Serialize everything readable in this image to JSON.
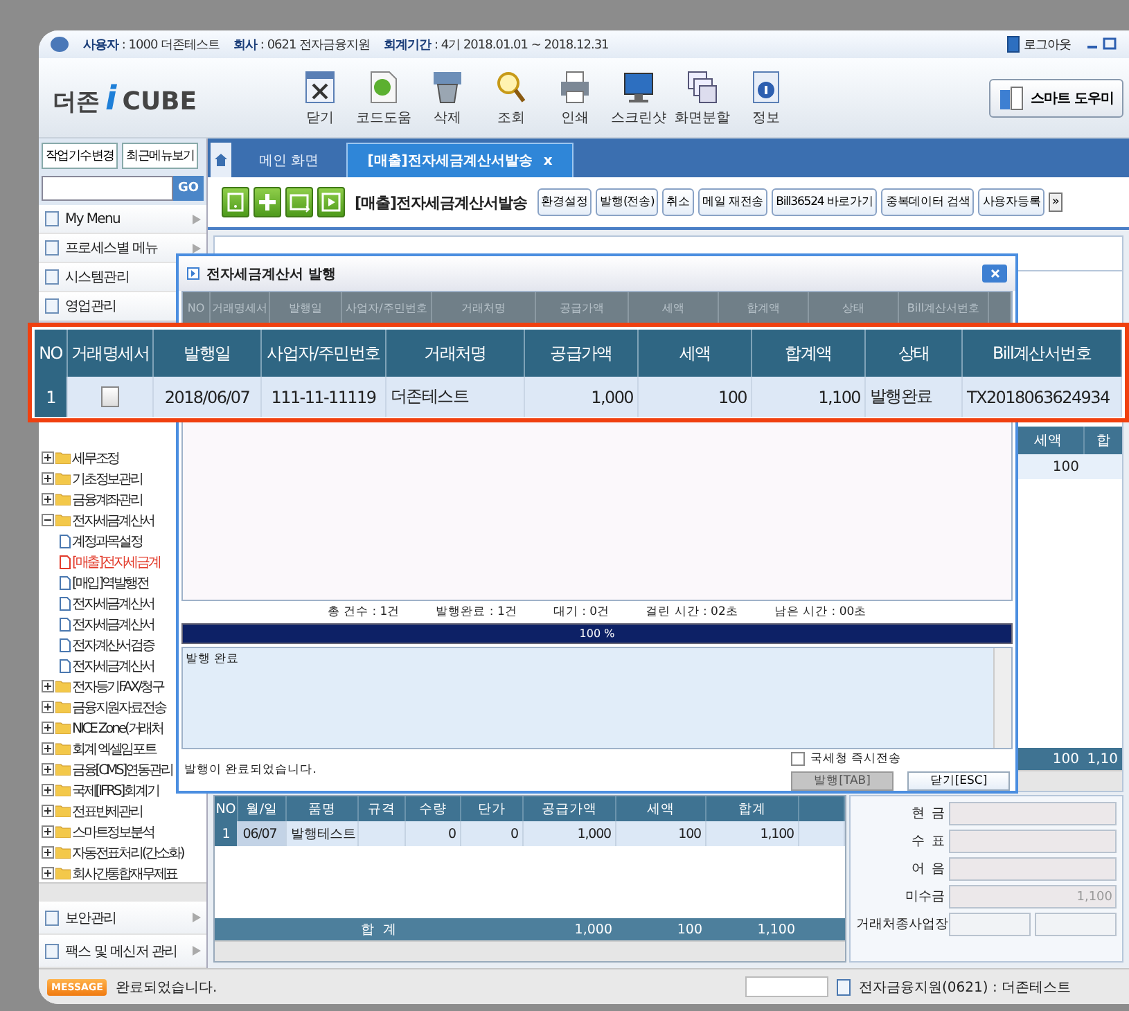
{
  "header": {
    "fields": [
      {
        "label": "사용자",
        "value": ": 1000 더존테스트"
      },
      {
        "label": "회사",
        "value": ": 0621 전자금융지원"
      },
      {
        "label": "회계기간",
        "value": ": 4기  2018.01.01 ~ 2018.12.31"
      }
    ],
    "logout": "로그아웃"
  },
  "logo": {
    "name": "더존",
    "accent": "i",
    "product": "CUBE"
  },
  "toolbar": [
    {
      "label": "닫기"
    },
    {
      "label": "코드도움"
    },
    {
      "label": "삭제"
    },
    {
      "label": "조회"
    },
    {
      "label": "인쇄"
    },
    {
      "label": "스크린샷"
    },
    {
      "label": "화면분할"
    },
    {
      "label": "정보"
    }
  ],
  "smart_helper": "스마트 도우미",
  "sidebar": {
    "buttons": [
      "작업기수변경",
      "최근메뉴보기"
    ],
    "search": {
      "button": "GO"
    },
    "menus": [
      "My Menu",
      "프로세스별 메뉴",
      "시스템관리",
      "영업관리"
    ],
    "tree": [
      {
        "label": "세무조정",
        "expanded": false
      },
      {
        "label": "기초정보관리",
        "expanded": false
      },
      {
        "label": "금융계좌관리",
        "expanded": false
      },
      {
        "label": "전자세금계산서",
        "expanded": true,
        "children": [
          {
            "label": "계정과목설정",
            "selected": false
          },
          {
            "label": "[매출]전자세금계",
            "selected": true
          },
          {
            "label": "[매입]역발행전",
            "selected": false
          },
          {
            "label": "전자세금계산서",
            "selected": false
          },
          {
            "label": "전자세금계산서",
            "selected": false
          },
          {
            "label": "전자계산서검증",
            "selected": false
          },
          {
            "label": "전자세금계산서",
            "selected": false
          }
        ]
      },
      {
        "label": "전자등기FAX/청구",
        "expanded": false
      },
      {
        "label": "금융지원자료전송",
        "expanded": false
      },
      {
        "label": "NICE Zone(거래처",
        "expanded": false
      },
      {
        "label": "회계 엑셀임포트",
        "expanded": false
      },
      {
        "label": "금융[CMS]연동관리",
        "expanded": false
      },
      {
        "label": "국제[IFRS]회계기",
        "expanded": false
      },
      {
        "label": "전표반제관리",
        "expanded": false
      },
      {
        "label": "스마트정보분석",
        "expanded": false
      },
      {
        "label": "자동전표처리(간소화)",
        "expanded": false
      },
      {
        "label": "회사간통합재무제표",
        "expanded": false
      }
    ],
    "bottom_menus": [
      "보안관리",
      "팩스 및 메신저 관리"
    ]
  },
  "tabs": [
    {
      "label": "메인 화면",
      "selected": false
    },
    {
      "label": "[매출]전자세금계산서발송",
      "selected": true
    }
  ],
  "tab_close": "x",
  "page": {
    "title": "[매출]전자세금계산서발송",
    "actions": [
      "환경설정",
      "발행(전송)",
      "취소",
      "메일 재전송",
      "Bill36524 바로가기",
      "중복데이터 검색",
      "사용자등록"
    ],
    "more": "»"
  },
  "back_grid": {
    "columns": [
      "세액",
      "합"
    ],
    "row": [
      "100"
    ],
    "total": [
      "100",
      "1,10"
    ]
  },
  "items_table": {
    "columns": [
      "NO",
      "월/일",
      "품명",
      "규격",
      "수량",
      "단가",
      "공급가액",
      "세액",
      "합계"
    ],
    "rows": [
      {
        "no": "1",
        "date": "06/07",
        "item": "발행테스트",
        "qty": "0",
        "price": "0",
        "supply": "1,000",
        "tax": "100",
        "sum": "1,100"
      }
    ],
    "total_label": "합  계",
    "total": [
      "1,000",
      "100",
      "1,100"
    ]
  },
  "payment": [
    {
      "label": "현  금",
      "kind": "single"
    },
    {
      "label": "수  표",
      "kind": "single"
    },
    {
      "label": "어  음",
      "kind": "single"
    },
    {
      "label": "미수금",
      "kind": "single",
      "value": "1,100"
    },
    {
      "label": "거래처종사업장",
      "kind": "double"
    }
  ],
  "dialog": {
    "title": "전자세금계산서 발행",
    "columns": [
      "NO",
      "거래명세서",
      "발행일",
      "사업자/주민번호",
      "거래처명",
      "공급가액",
      "세액",
      "합계액",
      "상태",
      "Bill계산서번호"
    ],
    "summary": [
      "총 건수 : 1건",
      "발행완료 : 1건",
      "대기 : 0건",
      "걸린 시간 : 02초",
      "남은 시간 : 00초"
    ],
    "progress": {
      "level": 1,
      "text": "100 %"
    },
    "log": "발행 완료",
    "message": "발행이 완료되었습니다.",
    "send_now": {
      "label": "국세청 즉시전송",
      "checked": false
    },
    "buttons": [
      {
        "label": "발행[TAB]",
        "disabled": true
      },
      {
        "label": "닫기[ESC]",
        "disabled": false
      }
    ]
  },
  "callout": {
    "columns": [
      "NO",
      "거래명세서",
      "발행일",
      "사업자/주민번호",
      "거래처명",
      "공급가액",
      "세액",
      "합계액",
      "상태",
      "Bill계산서번호"
    ],
    "rows": [
      {
        "no": "1",
        "statement_checked": false,
        "date": "2018/06/07",
        "biz_no": "111-11-11119",
        "client": "더존테스트",
        "supply": "1,000",
        "tax": "100",
        "total": "1,100",
        "status": "발행완료",
        "bill_no": "TX2018063624934"
      }
    ]
  },
  "status_bar": {
    "badge": "MESSAGE",
    "message": "완료되었습니다.",
    "company": "전자금융지원(0621) : 더존테스트"
  }
}
